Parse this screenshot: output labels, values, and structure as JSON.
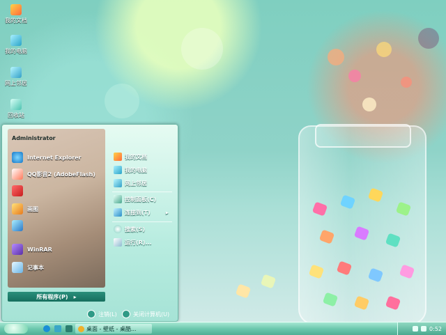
{
  "desktop": {
    "icons": [
      {
        "label": "我的文档",
        "icon": "my-documents-icon"
      },
      {
        "label": "我的电脑",
        "icon": "my-computer-icon"
      },
      {
        "label": "网上邻居",
        "icon": "network-places-icon"
      },
      {
        "label": "回收站",
        "icon": "recycle-bin-icon"
      }
    ]
  },
  "start_menu": {
    "user": "Administrator",
    "programs": [
      {
        "label": "Internet Explorer",
        "icon": "internet-explorer-icon"
      },
      {
        "label": "QQ影音2 (AdobeFlash)",
        "icon": "qq-player-icon"
      },
      {
        "label": "",
        "icon": "media-icon"
      },
      {
        "label": "画图",
        "icon": "paint-icon"
      },
      {
        "label": "",
        "icon": "remote-desktop-icon"
      },
      {
        "label": "WinRAR",
        "icon": "winrar-icon"
      },
      {
        "label": "记事本",
        "icon": "notepad-icon"
      }
    ],
    "all_programs": "所有程序(P)",
    "places": [
      {
        "label": "我的文档",
        "icon": "my-documents-icon"
      },
      {
        "label": "我的电脑",
        "icon": "my-computer-icon"
      },
      {
        "label": "网上邻居",
        "icon": "network-places-icon"
      }
    ],
    "system": [
      {
        "label": "控制面板(C)",
        "icon": "control-panel-icon"
      },
      {
        "label": "连接到(T)",
        "icon": "connect-icon"
      },
      {
        "label": "搜索(S)",
        "icon": "search-icon"
      },
      {
        "label": "运行(R)...",
        "icon": "run-icon"
      }
    ],
    "logoff_label": "注销(L)",
    "shutdown_label": "关闭计算机(U)"
  },
  "taskbar": {
    "task_label": "桌面 - 壁纸 - 桌酷...",
    "clock": "0:52"
  },
  "colors": {
    "accent": "#2f9a86",
    "taskbar": "#6cc8ae"
  }
}
